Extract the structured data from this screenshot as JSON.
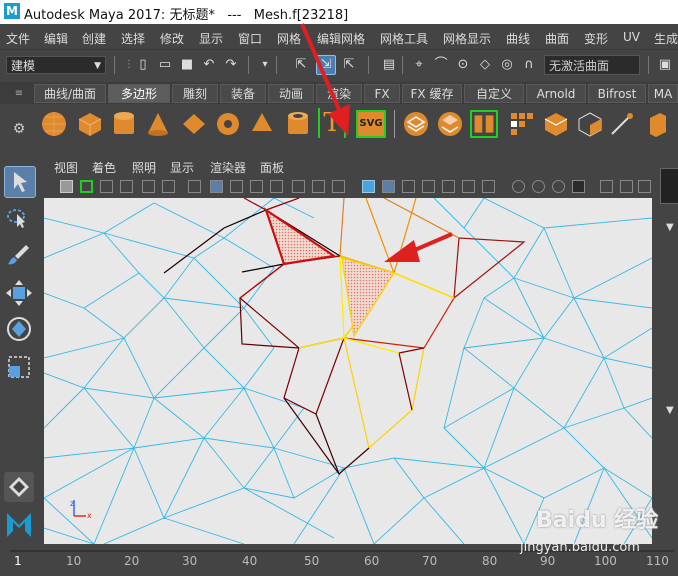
{
  "window": {
    "title": "Autodesk Maya 2017: 无标题*   ---   Mesh.f[23218]",
    "logo_letter": "M"
  },
  "menubar": {
    "items": [
      "文件",
      "编辑",
      "创建",
      "选择",
      "修改",
      "显示",
      "窗口",
      "网格",
      "编辑网格",
      "网格工具",
      "网格显示",
      "曲线",
      "曲面",
      "变形",
      "UV",
      "生成"
    ]
  },
  "status_line": {
    "mode": "建模",
    "live_surface": "无激活曲面"
  },
  "shelf": {
    "tabs": [
      "曲线/曲面",
      "多边形",
      "雕刻",
      "装备",
      "动画",
      "渲染",
      "FX",
      "FX 缓存",
      "自定义",
      "Arnold",
      "Bifrost",
      "MA"
    ],
    "active_tab": "多边形",
    "text_tool_glyph": "T",
    "svg_tool_label": "SVG"
  },
  "panel": {
    "menu": [
      "视图",
      "着色",
      "照明",
      "显示",
      "渲染器",
      "面板"
    ]
  },
  "timeline": {
    "first_frame": "1",
    "ticks": [
      "10",
      "20",
      "30",
      "40",
      "50",
      "60",
      "70",
      "80",
      "90",
      "100",
      "110"
    ]
  },
  "watermark": {
    "site_cn": "Baidu 经验",
    "url": "jingyan.baidu.com"
  },
  "colors": {
    "accent_highlight": "#4aa3e0",
    "arrow_red": "#e02020",
    "mesh_wire": "#34b8e8"
  }
}
